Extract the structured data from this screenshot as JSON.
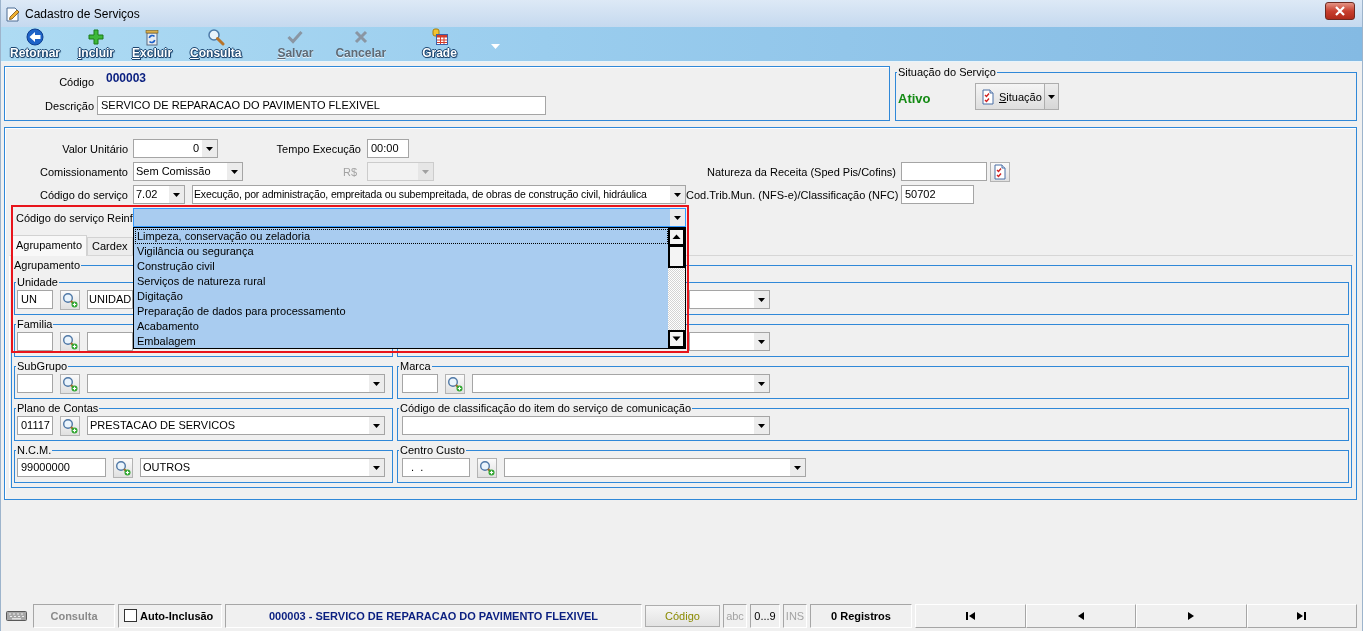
{
  "window": {
    "title": "Cadastro de Serviços"
  },
  "toolbar": [
    {
      "kind": "back",
      "label": "Retornar",
      "mnemonic": false,
      "disabled": false
    },
    {
      "kind": "add",
      "label": "Incluir",
      "mnemonic": true,
      "disabled": false
    },
    {
      "kind": "delete",
      "label": "Excluir",
      "mnemonic": true,
      "disabled": false
    },
    {
      "kind": "search",
      "label": "Consulta",
      "mnemonic": true,
      "disabled": false
    },
    {
      "kind": "save",
      "label": "Salvar",
      "mnemonic": true,
      "disabled": true
    },
    {
      "kind": "cancel",
      "label": "Cancelar",
      "mnemonic": false,
      "disabled": true
    },
    {
      "kind": "grid",
      "label": "Grade",
      "mnemonic": false,
      "disabled": false
    }
  ],
  "record": {
    "code_label": "Código",
    "code": "000003",
    "description_label": "Descrição",
    "description": "SERVICO DE REPARACAO DO PAVIMENTO FLEXIVEL"
  },
  "status_group": {
    "title": "Situação do Serviço",
    "status": "Ativo",
    "button": {
      "label": "Situação",
      "mnemonic": true
    }
  },
  "form": {
    "unit_value": {
      "label": "Valor Unitário",
      "value": "0"
    },
    "execution_time": {
      "label": "Tempo Execução",
      "value": "00:00"
    },
    "commission": {
      "label": "Comissionamento",
      "value": "Sem Comissão"
    },
    "commission_amount": {
      "label": "R$",
      "disabled": true
    },
    "revenue_nature": {
      "label": "Natureza da Receita (Sped Pis/Cofins)"
    },
    "service_code": {
      "label": "Código do serviço",
      "code": "7.02",
      "description": "Execução, por administração, empreitada ou subempreitada, de obras de construção civil, hidráulica"
    },
    "municipal_code": {
      "label": "Cod.Trib.Mun. (NFS-e)/Classificação (NFC)",
      "value": "50702"
    },
    "reinf_code": {
      "label": "Código do serviço Reinf",
      "focused": true,
      "expanded": true,
      "options": [
        {
          "label": "Limpeza, conservação ou zeladoria",
          "selected": true
        },
        {
          "label": "Vigilância ou segurança",
          "selected": false
        },
        {
          "label": "Construção civil",
          "selected": false
        },
        {
          "label": "Serviços de natureza rural",
          "selected": false
        },
        {
          "label": "Digitação",
          "selected": false
        },
        {
          "label": "Preparação de dados para processamento",
          "selected": false
        },
        {
          "label": "Acabamento",
          "selected": false
        },
        {
          "label": "Embalagem",
          "selected": false
        }
      ]
    }
  },
  "tabs": [
    {
      "label": "Agrupamento",
      "selected": true
    },
    {
      "label": "Cardex",
      "selected": false
    }
  ],
  "grouping": {
    "title": "Agrupamento",
    "rows": [
      [
        {
          "kind": "lookup",
          "title": "Unidade",
          "code": "UN",
          "description": "UNIDAD"
        },
        {
          "kind": "select"
        }
      ],
      [
        {
          "kind": "lookup",
          "title": "Familia"
        },
        {
          "kind": "select"
        }
      ],
      [
        {
          "kind": "lookup",
          "title": "SubGrupo"
        },
        {
          "kind": "lookup",
          "title": "Marca"
        }
      ],
      [
        {
          "kind": "lookup",
          "title": "Plano de Contas",
          "code": "01117",
          "description": "PRESTACAO DE SERVICOS"
        },
        {
          "kind": "select",
          "title": "Código de classificação do item do serviço de comunicação"
        }
      ],
      [
        {
          "kind": "number",
          "title": "N.C.M.",
          "code": "99000000",
          "description": "OUTROS"
        },
        {
          "kind": "masked",
          "title": "Centro Custo",
          "code": ".  ."
        }
      ]
    ]
  },
  "status_bar": {
    "mode": "Consulta",
    "auto_include": {
      "label": "Auto-Inclusão",
      "checked": false
    },
    "record": "000003 - SERVICO DE REPARACAO DO PAVIMENTO FLEXIVEL",
    "search_key": "Código",
    "indicators": [
      {
        "label": "abc",
        "on": false
      },
      {
        "label": "0...9",
        "on": true
      },
      {
        "label": "INS",
        "on": false
      }
    ],
    "count": "0 Registros"
  }
}
